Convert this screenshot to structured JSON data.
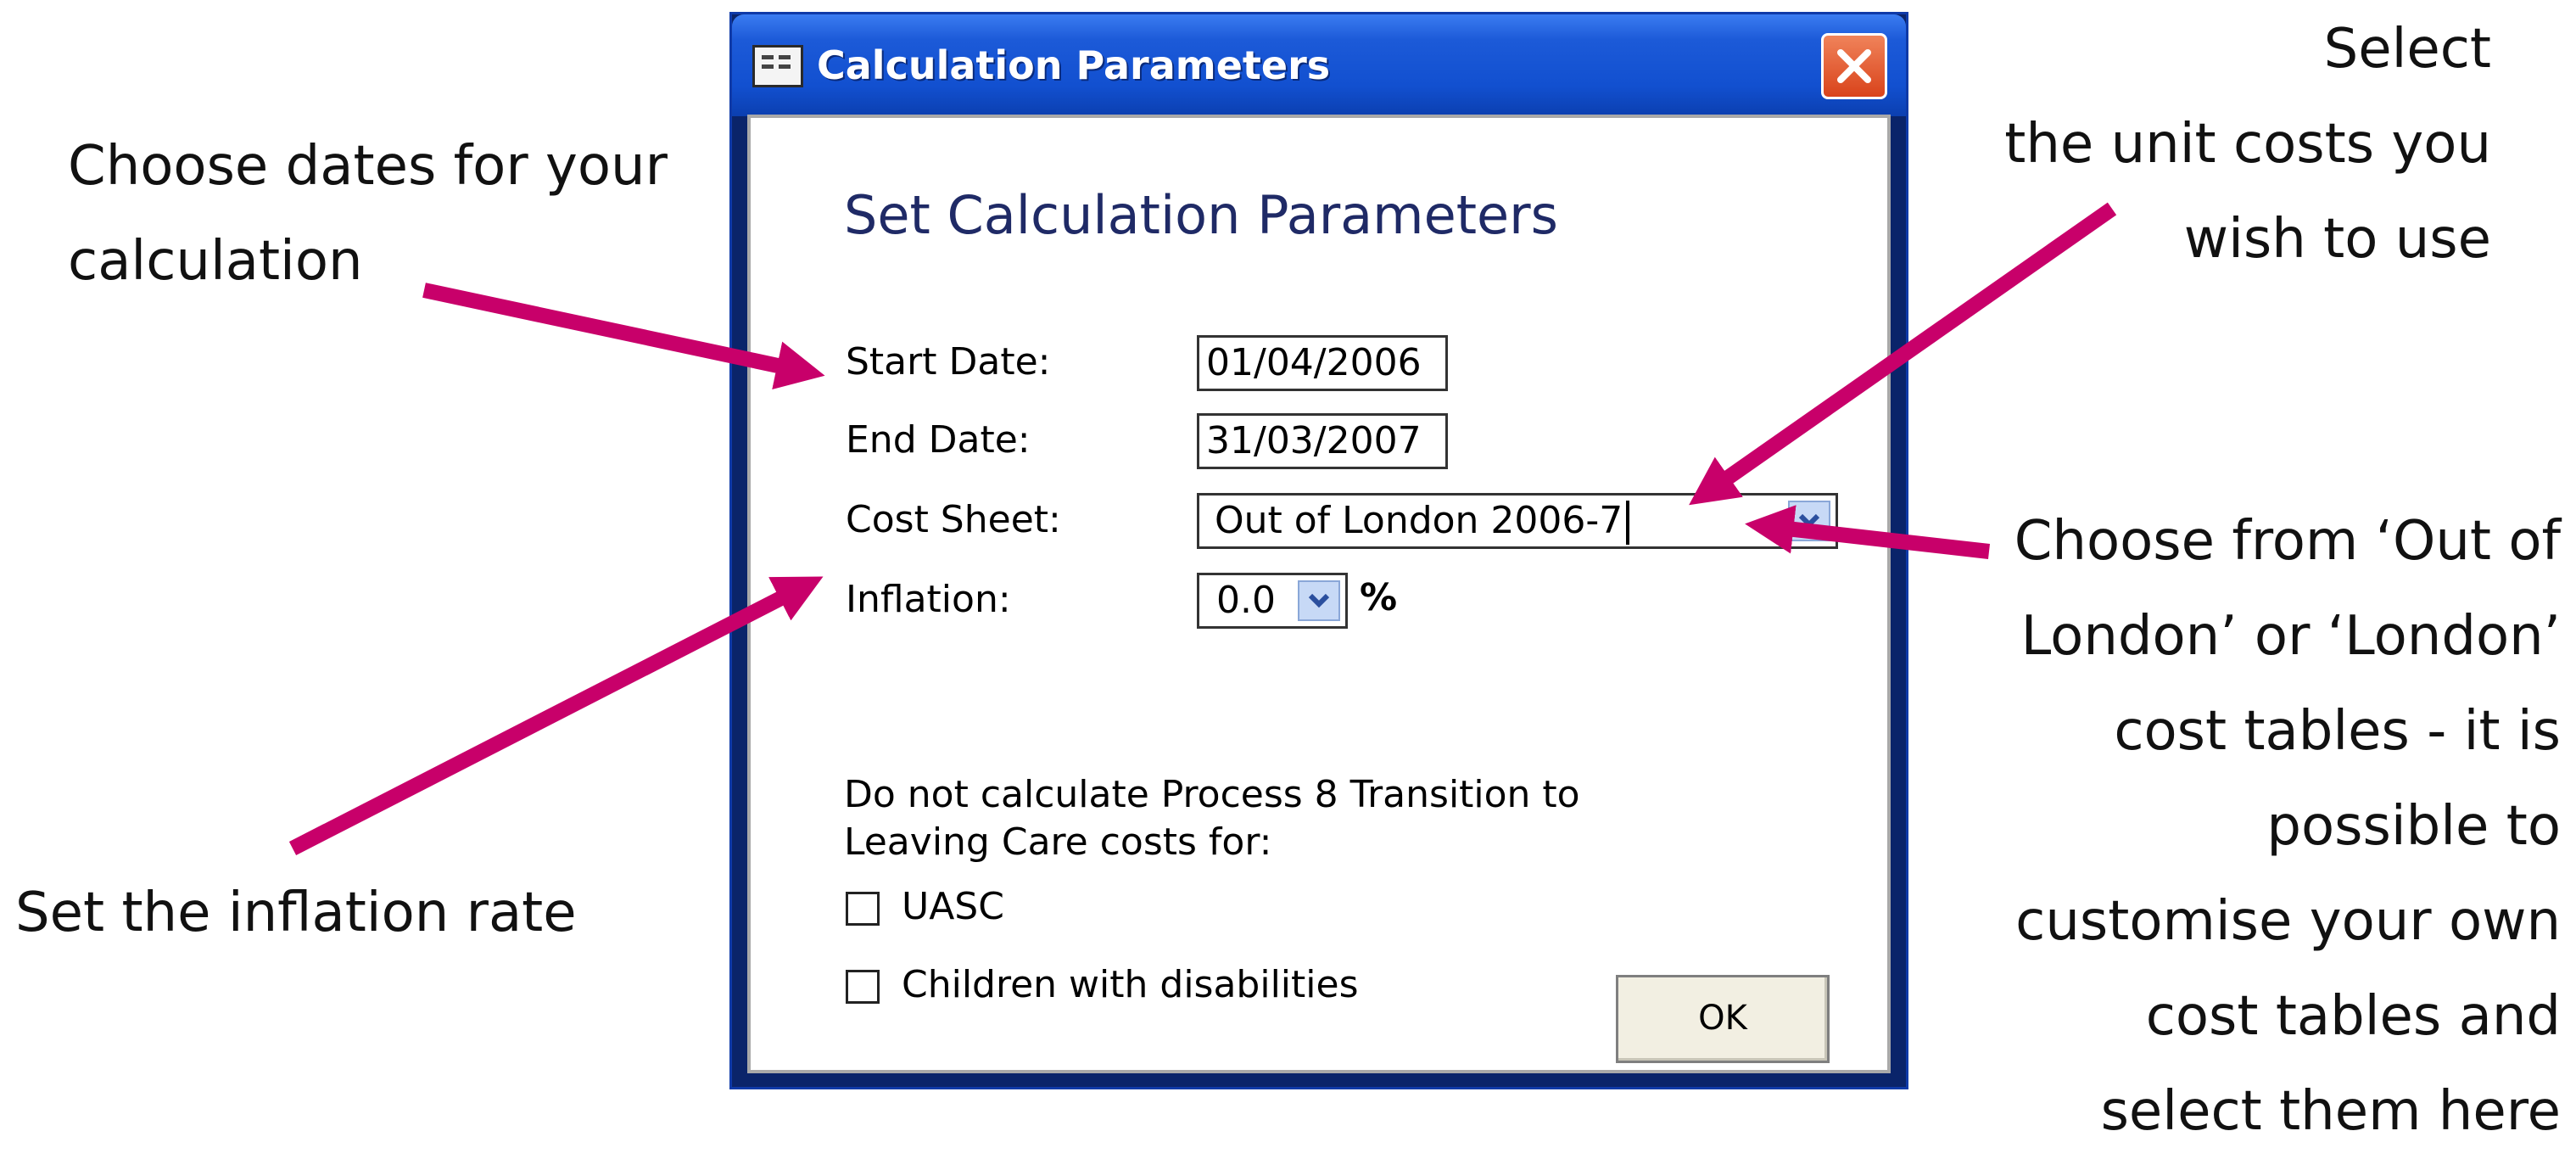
{
  "dialog": {
    "title": "Calculation Parameters",
    "heading": "Set Calculation Parameters",
    "start_date_label": "Start Date:",
    "start_date_value": "01/04/2006",
    "end_date_label": "End Date:",
    "end_date_value": "31/03/2007",
    "cost_sheet_label": "Cost Sheet:",
    "cost_sheet_value": "Out of London 2006-7",
    "inflation_label": "Inflation:",
    "inflation_value": "0.0",
    "inflation_unit": "%",
    "exclude_text_line1": "Do not calculate Process 8 Transition to",
    "exclude_text_line2": "Leaving Care costs for:",
    "checkbox_uasc_label": "UASC",
    "checkbox_disabilities_label": "Children with disabilities",
    "ok_label": "OK"
  },
  "annotations": {
    "dates": [
      "Choose dates for your",
      "calculation"
    ],
    "inflation": [
      "Set the inflation rate"
    ],
    "unit_costs": [
      "Select",
      "the unit costs you",
      "wish to use"
    ],
    "cost_tables": [
      "Choose from ‘Out of",
      "London’ or ‘London’",
      "cost tables - it is",
      "possible to",
      "customise your own",
      "cost tables and",
      "select them here"
    ]
  },
  "colors": {
    "arrow": "#c8006a",
    "titlebar": "#1c5ad8",
    "heading": "#1f2a66",
    "close": "#d9431b"
  }
}
